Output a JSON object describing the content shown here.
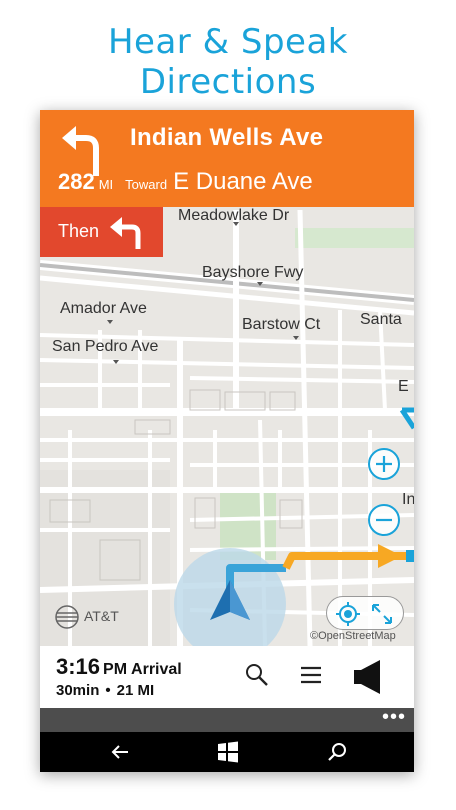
{
  "promo": {
    "line1": "Hear & Speak",
    "line2": "Directions"
  },
  "banner": {
    "street": "Indian Wells Ave",
    "distance": "282",
    "distance_unit": "MI",
    "toward_label": "Toward",
    "toward_street": "E Duane Ave"
  },
  "then": {
    "label": "Then"
  },
  "map": {
    "labels": {
      "meadowlake": "Meadowlake Dr",
      "bayshore": "Bayshore Fwy",
      "amador": "Amador Ave",
      "barstow": "Barstow Ct",
      "santa": "Santa",
      "sanpedro": "San Pedro Ave",
      "e_cut": "E",
      "in_cut": "In"
    },
    "brand": "AT&T",
    "attribution": "©OpenStreetMap",
    "colors": {
      "route": "#f7a823",
      "route_past": "#3aa3d9",
      "vehicle": "#1e6fb0",
      "accent": "#1aa3d9"
    }
  },
  "arrival": {
    "time": "3:16",
    "ampm": "PM",
    "label": "Arrival",
    "duration": "30min",
    "separator": "•",
    "distance": "21 MI"
  },
  "icons": {
    "zoom_in": "plus-icon",
    "zoom_out": "minus-icon",
    "locate": "crosshair-icon",
    "expand": "expand-icon",
    "search": "search-icon",
    "menu": "hamburger-icon",
    "voice": "speaker-icon",
    "back": "back-arrow-icon",
    "start": "windows-logo-icon",
    "os_search": "search-icon"
  },
  "appbar": {
    "more": "•••"
  }
}
